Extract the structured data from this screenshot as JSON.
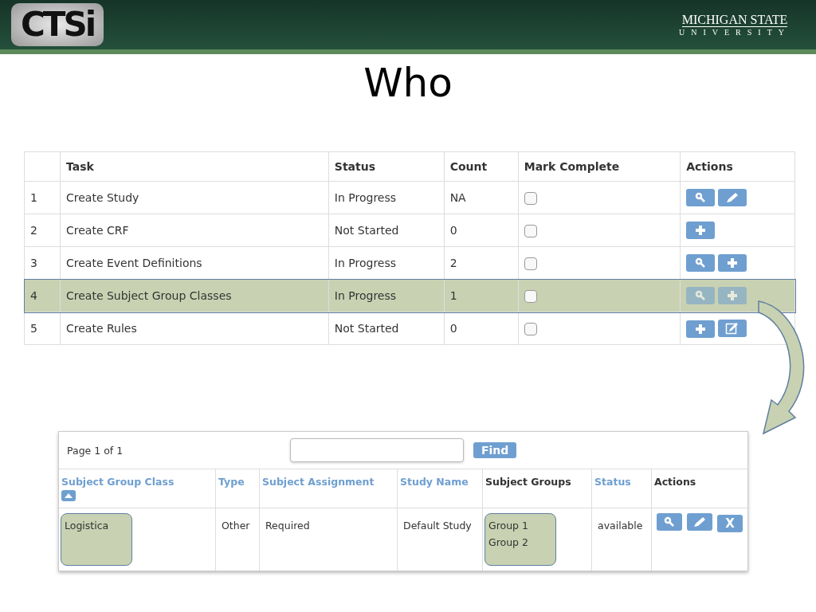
{
  "header": {
    "logo": "CTSi",
    "university": "MICHIGAN STATE",
    "university_sub": "UNIVERSITY"
  },
  "title": "Who",
  "tasks": {
    "columns": [
      "Task",
      "Status",
      "Count",
      "Mark Complete",
      "Actions"
    ],
    "rows": [
      {
        "number": "1",
        "task": "Create Study",
        "status": "In Progress",
        "count": "NA",
        "checked": false,
        "highlighted": false,
        "actions": [
          {
            "kind": "view"
          },
          {
            "kind": "edit"
          }
        ]
      },
      {
        "number": "2",
        "task": "Create CRF",
        "status": "Not Started",
        "count": "0",
        "checked": false,
        "highlighted": false,
        "actions": [
          {
            "kind": "add"
          }
        ]
      },
      {
        "number": "3",
        "task": "Create Event Definitions",
        "status": "In Progress",
        "count": "2",
        "checked": false,
        "highlighted": false,
        "actions": [
          {
            "kind": "view"
          },
          {
            "kind": "add"
          }
        ]
      },
      {
        "number": "4",
        "task": "Create Subject Group Classes",
        "status": "In Progress",
        "count": "1",
        "checked": false,
        "highlighted": true,
        "actions": [
          {
            "kind": "view"
          },
          {
            "kind": "add"
          }
        ]
      },
      {
        "number": "5",
        "task": "Create Rules",
        "status": "Not Started",
        "count": "0",
        "checked": false,
        "highlighted": false,
        "actions": [
          {
            "kind": "add"
          },
          {
            "kind": "review"
          }
        ]
      }
    ]
  },
  "groups": {
    "pager": "Page 1 of 1",
    "find_button": "Find",
    "columns": [
      {
        "label": "Subject Group Class",
        "kind": "link",
        "sorted": true
      },
      {
        "label": "Type",
        "kind": "link",
        "sorted": false
      },
      {
        "label": "Subject Assignment",
        "kind": "link",
        "sorted": false
      },
      {
        "label": "Study Name",
        "kind": "link",
        "sorted": false
      },
      {
        "label": "Subject Groups",
        "kind": "plain",
        "sorted": false
      },
      {
        "label": "Status",
        "kind": "link",
        "sorted": false
      },
      {
        "label": "Actions",
        "kind": "plain",
        "sorted": false
      }
    ],
    "rows": [
      {
        "cells": [
          {
            "lines": [
              "Logistica"
            ],
            "highlighted": true
          },
          {
            "lines": [
              "Other"
            ],
            "highlighted": false
          },
          {
            "lines": [
              "Required"
            ],
            "highlighted": false
          },
          {
            "lines": [
              "Default Study"
            ],
            "highlighted": false
          },
          {
            "lines": [
              "Group 1",
              "Group 2"
            ],
            "highlighted": true
          },
          {
            "lines": [
              "available"
            ],
            "highlighted": false
          }
        ],
        "actions": [
          {
            "kind": "view"
          },
          {
            "kind": "edit"
          },
          {
            "kind": "text",
            "label": "X"
          }
        ]
      }
    ]
  }
}
